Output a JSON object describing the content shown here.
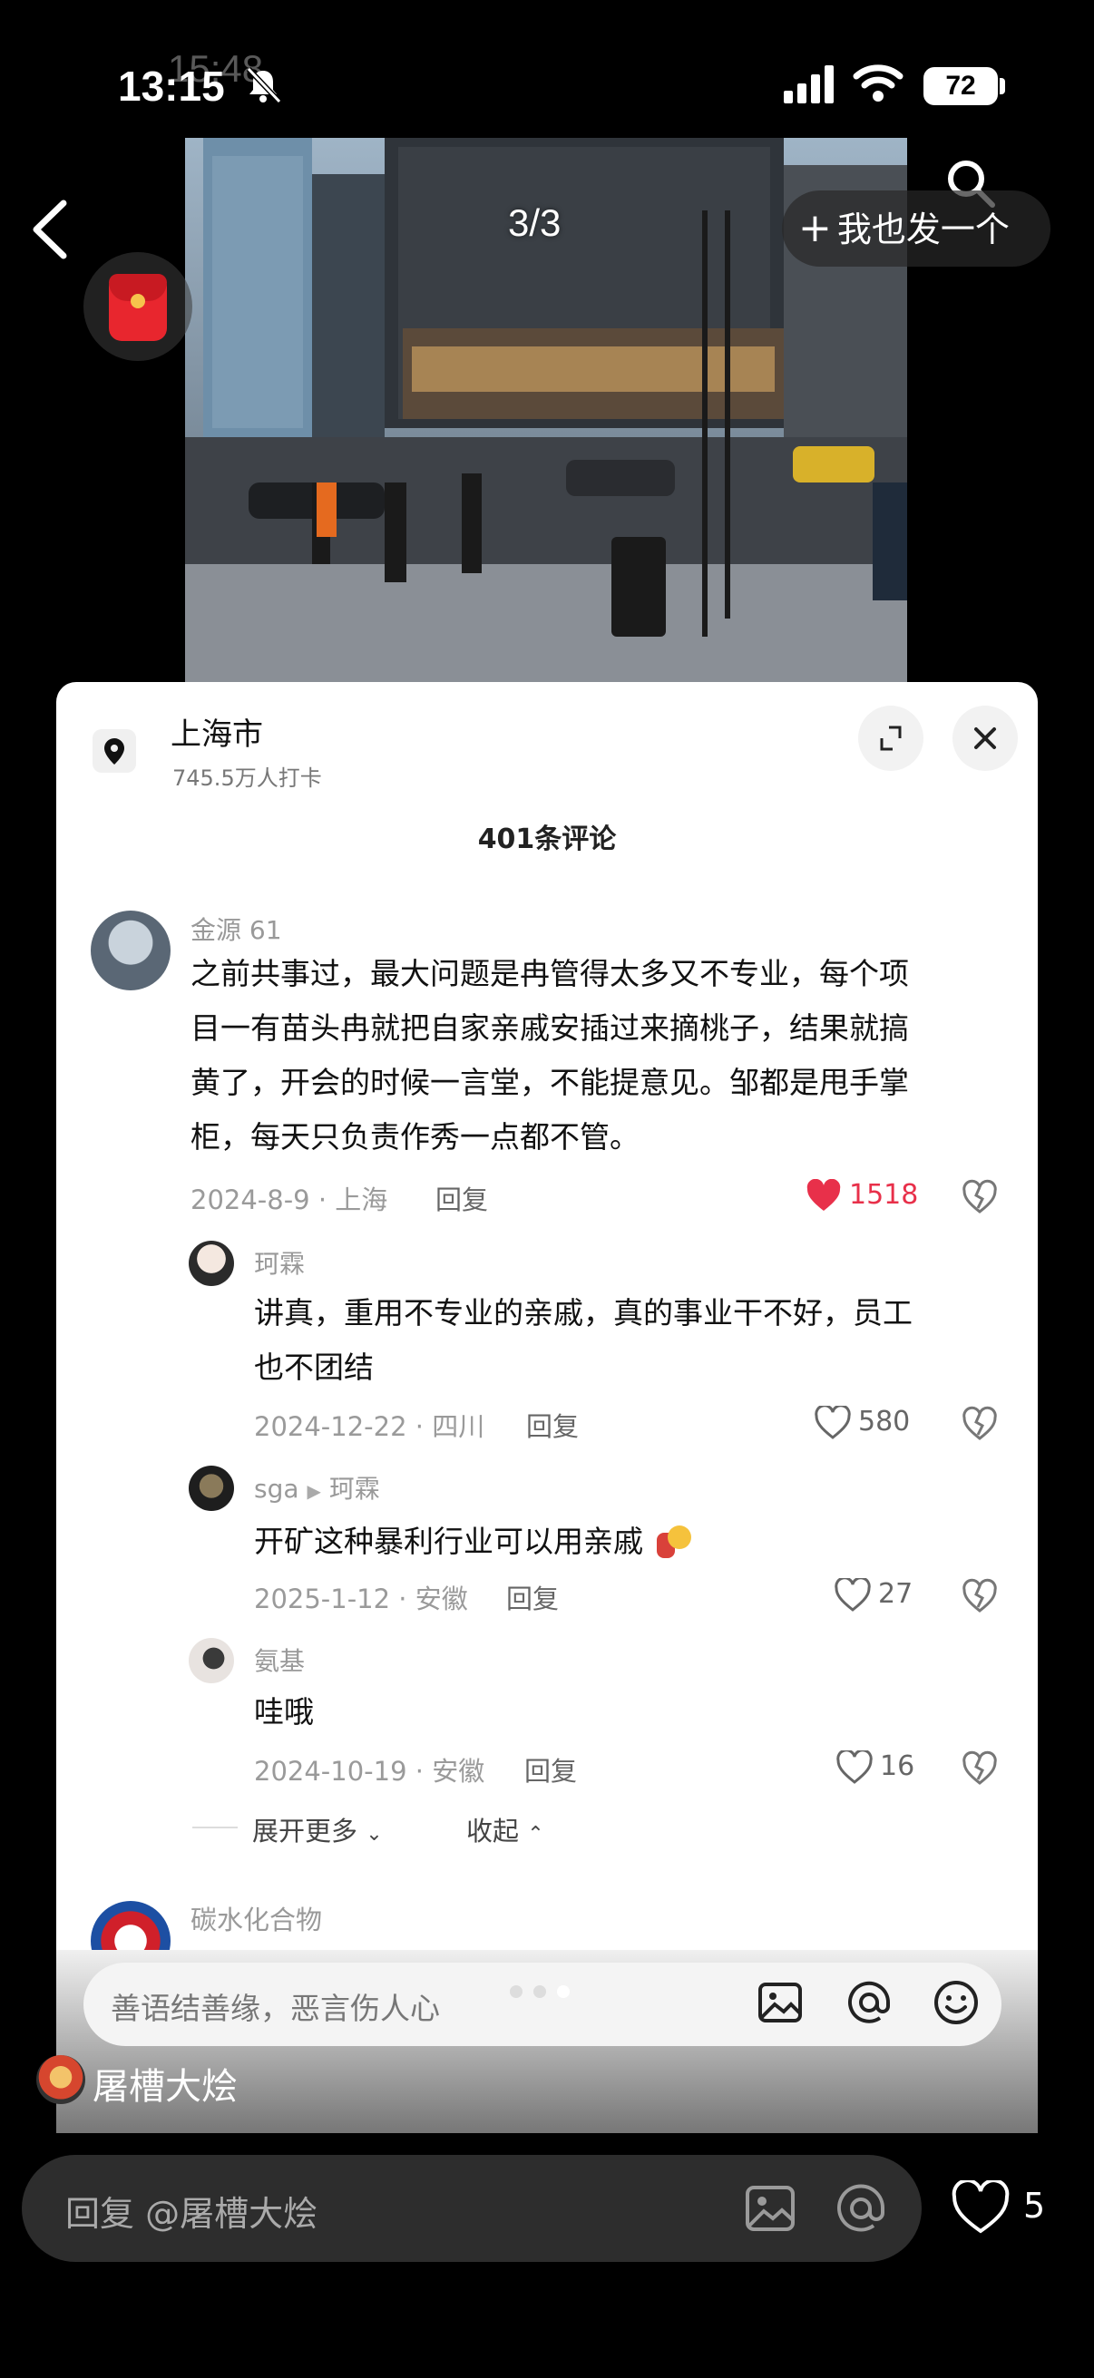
{
  "status_bar": {
    "time": "13:15",
    "ghost_time": "15:48",
    "battery": "72"
  },
  "header": {
    "page_indicator": "3/3",
    "post_button": "我也发一个"
  },
  "location": {
    "name": "上海市",
    "checkins": "745.5万人打卡"
  },
  "comments_title": "401条评论",
  "comments": [
    {
      "user": "金源 61",
      "text_lines": [
        "之前共事过，最大问题是冉管得太多又不专业，每个项",
        "目一有苗头冉就把自家亲戚安插过来摘桃子，结果就搞",
        "黄了，开会的时候一言堂，不能提意见。邹都是甩手掌",
        "柜，每天只负责作秀一点都不管。"
      ],
      "meta": "2024-8-9 · 上海",
      "reply": "回复",
      "likes": "1518",
      "liked": true
    },
    {
      "user": "珂霖",
      "text_lines": [
        "讲真，重用不专业的亲戚，真的事业干不好，员工",
        "也不团结"
      ],
      "meta": "2024-12-22 · 四川",
      "reply": "回复",
      "likes": "580"
    },
    {
      "user": "sga",
      "reply_to": "珂霖",
      "text_lines": [
        "开矿这种暴利行业可以用亲戚"
      ],
      "meta": "2025-1-12 · 安徽",
      "reply": "回复",
      "likes": "27"
    },
    {
      "user": "氨基",
      "text_lines": [
        "哇哦"
      ],
      "meta": "2024-10-19 · 安徽",
      "reply": "回复",
      "likes": "16"
    }
  ],
  "thread_controls": {
    "expand": "展开更多",
    "collapse": "收起"
  },
  "next_comment_user": "碳水化合物",
  "panel_input": {
    "placeholder": "善语结善缘，恶言伤人心"
  },
  "author": {
    "name": "屠槽大烩"
  },
  "reply_bar": {
    "placeholder": "回复 @屠槽大烩",
    "likes": "5"
  },
  "colors": {
    "like_red": "#e8304a",
    "background": "#000000",
    "panel": "#ffffff"
  },
  "icons": [
    "back-icon",
    "search-icon",
    "red-packet-icon",
    "location-pin-icon",
    "expand-icon",
    "close-icon",
    "heart-icon",
    "dislike-icon",
    "image-icon",
    "at-icon",
    "emoji-icon"
  ]
}
